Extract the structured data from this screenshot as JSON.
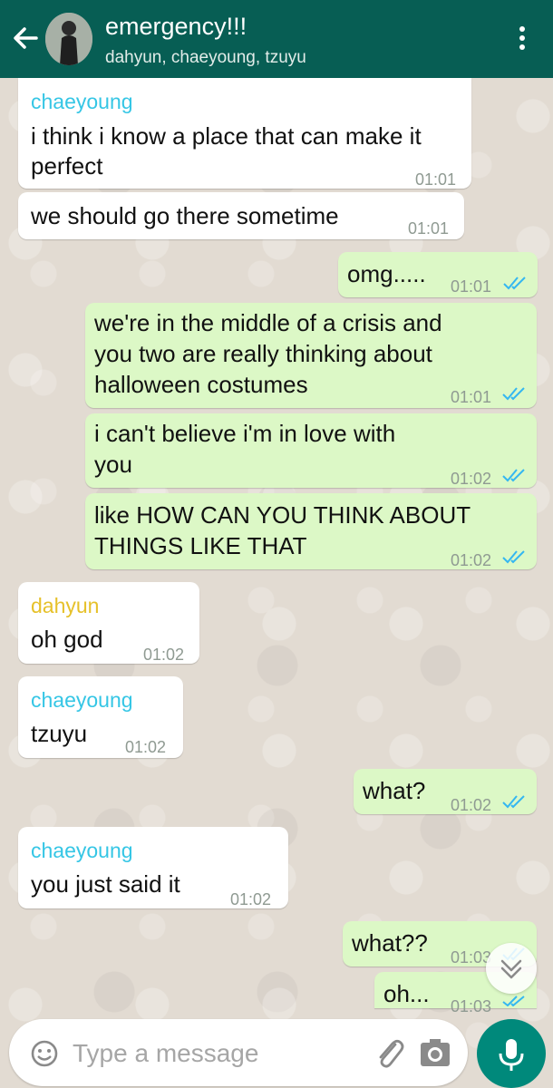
{
  "header": {
    "title": "emergency!!!",
    "participants": "dahyun, chaeyoung, tzuyu"
  },
  "colors": {
    "header_bg": "#075e54",
    "incoming_bubble": "#ffffff",
    "outgoing_bubble": "#dcf8c6",
    "read_ticks": "#34b7f1",
    "mic_button": "#00897b"
  },
  "messages": [
    {
      "direction": "incoming",
      "sender": "chaeyoung",
      "sender_color": "#35c6e5",
      "lines": [
        "i think i know a place that can make it",
        "perfect"
      ],
      "time": "01:01"
    },
    {
      "direction": "incoming",
      "sender": "",
      "lines": [
        "we should go there sometime"
      ],
      "time": "01:01"
    },
    {
      "direction": "outgoing",
      "lines": [
        "omg....."
      ],
      "time": "01:01",
      "status": "read"
    },
    {
      "direction": "outgoing",
      "lines": [
        "we're in the middle of a crisis and",
        "you two are really thinking about",
        "halloween costumes"
      ],
      "time": "01:01",
      "status": "read"
    },
    {
      "direction": "outgoing",
      "lines": [
        "i can't believe i'm in love with",
        "you"
      ],
      "time": "01:02",
      "status": "read"
    },
    {
      "direction": "outgoing",
      "lines": [
        "like HOW CAN YOU THINK ABOUT",
        "THINGS LIKE THAT"
      ],
      "time": "01:02",
      "status": "read"
    },
    {
      "direction": "incoming",
      "sender": "dahyun",
      "sender_color": "#e6c12a",
      "lines": [
        "oh god"
      ],
      "time": "01:02"
    },
    {
      "direction": "incoming",
      "sender": "chaeyoung",
      "sender_color": "#35c6e5",
      "lines": [
        "tzuyu"
      ],
      "time": "01:02"
    },
    {
      "direction": "outgoing",
      "lines": [
        "what?"
      ],
      "time": "01:02",
      "status": "read"
    },
    {
      "direction": "incoming",
      "sender": "chaeyoung",
      "sender_color": "#35c6e5",
      "lines": [
        "you just said it"
      ],
      "time": "01:02"
    },
    {
      "direction": "outgoing",
      "lines": [
        "what??"
      ],
      "time": "01:03",
      "status": "read"
    },
    {
      "direction": "outgoing",
      "lines": [
        "oh..."
      ],
      "time": "01:03",
      "status": "read"
    }
  ],
  "composer": {
    "placeholder": "Type a message",
    "emoji_icon": "emoji-icon",
    "attach_icon": "paperclip-icon",
    "camera_icon": "camera-icon",
    "mic_icon": "mic-icon"
  }
}
